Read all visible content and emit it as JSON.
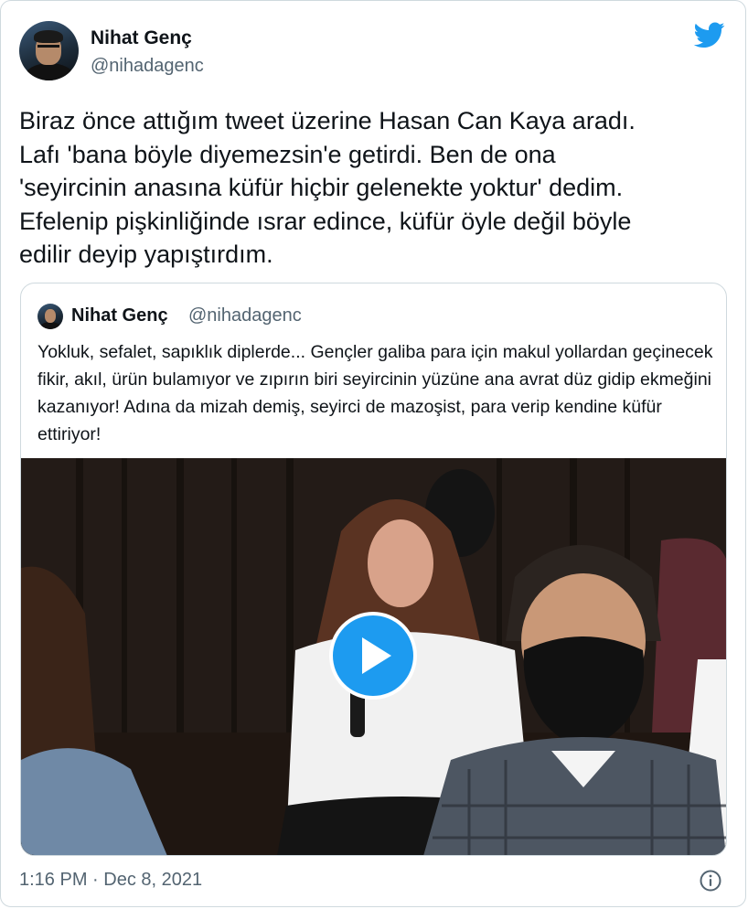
{
  "author": {
    "name": "Nihat Genç",
    "handle": "@nihadagenc"
  },
  "tweet": {
    "text": "Biraz önce attığım tweet üzerine Hasan Can Kaya aradı.\nLafı 'bana böyle diyemezsin'e getirdi. Ben de ona\n'seyircinin anasına küfür hiçbir gelenekte yoktur' dedim.\nEfelenip pişkinliğinde ısrar edince, küfür öyle değil böyle\nedilir deyip yapıştırdım.",
    "timestamp": "1:16 PM · Dec 8, 2021"
  },
  "quoted_tweet": {
    "name": "Nihat Genç",
    "handle": "@nihadagenc",
    "text": "Yokluk, sefalet, sapıklık diplerde... Gençler galiba para için makul yollardan geçinecek fikir, akıl, ürün bulamıyor ve zıpırın biri seyircinin yüzüne ana avrat düz gidip ekmeğini kazanıyor! Adına da mizah demiş, seyirci de mazoşist, para verip kendine küfür ettiriyor!"
  },
  "icons": {
    "brand": "twitter-bird-icon",
    "play": "play-icon",
    "info": "info-icon"
  },
  "colors": {
    "accent": "#1d9bf0",
    "text_primary": "#0f1419",
    "text_secondary": "#536471",
    "border": "#cfd9de"
  }
}
